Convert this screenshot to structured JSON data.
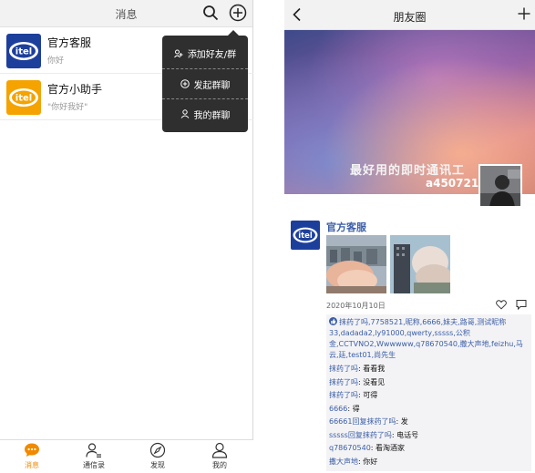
{
  "left": {
    "title": "消息",
    "conversations": [
      {
        "name": "官方客服",
        "message": "你好",
        "avatar": "itel-logo-blue"
      },
      {
        "name": "官方小助手",
        "message": "\"你好我好\"",
        "avatar": "itel-logo-orange"
      }
    ],
    "popup": [
      {
        "label": "添加好友/群",
        "icon": "add-friend-icon"
      },
      {
        "label": "发起群聊",
        "icon": "start-chat-icon"
      },
      {
        "label": "我的群聊",
        "icon": "my-groups-icon"
      }
    ],
    "tabs": [
      {
        "label": "消息",
        "icon": "chat-bubble-icon",
        "active": true
      },
      {
        "label": "通信录",
        "icon": "contacts-icon",
        "active": false
      },
      {
        "label": "发现",
        "icon": "compass-icon",
        "active": false
      },
      {
        "label": "我的",
        "icon": "user-icon",
        "active": false
      }
    ],
    "accent_color": "#f08a00"
  },
  "right": {
    "title": "朋友圈",
    "cover": {
      "slogan": "最好用的即时通讯工",
      "username": "a450721"
    },
    "post": {
      "author": "官方客服",
      "date": "2020年10月10日",
      "likes": "抹药了吗,7758521,昵称,6666,妹夫,路哥,测试昵称33,dadada2,ly91000,qwerty,sssss,公积金,CCTVNO2,Wwwwww,q78670540,撒大声地,feizhu,马云,廷,test01,尚先生",
      "comments": [
        {
          "name": "抹药了吗",
          "text": "看看我"
        },
        {
          "name": "抹药了吗",
          "text": "没看见"
        },
        {
          "name": "抹药了吗",
          "text": "可得"
        },
        {
          "name": "6666",
          "text": "得"
        },
        {
          "name": "66661回复抹药了吗",
          "text": "发"
        },
        {
          "name": "sssss回复抹药了吗",
          "text": "电话号"
        },
        {
          "name": "q78670540",
          "text": "看淘酒家"
        },
        {
          "name": "撒大声地",
          "text": "你好"
        }
      ]
    },
    "link_color": "#3b5ea6"
  }
}
